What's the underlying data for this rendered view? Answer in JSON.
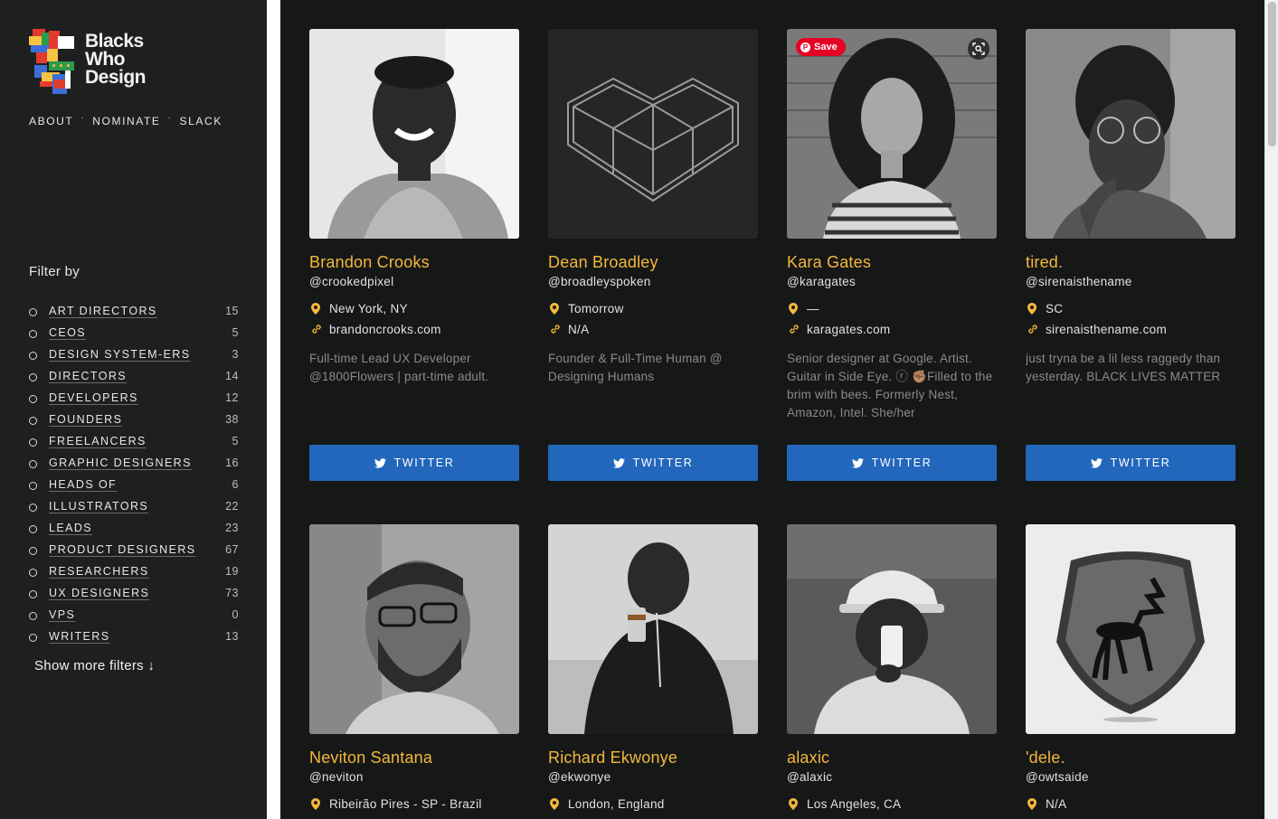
{
  "brand": {
    "line1": "Blacks",
    "line2": "Who",
    "line3": "Design"
  },
  "nav": {
    "about": "ABOUT",
    "sep": "·",
    "nominate": "NOMINATE",
    "slack": "SLACK"
  },
  "filters": {
    "title": "Filter by",
    "items": [
      {
        "label": "ART DIRECTORS",
        "count": "15"
      },
      {
        "label": "CEOS",
        "count": "5"
      },
      {
        "label": "DESIGN SYSTEM-ERS",
        "count": "3"
      },
      {
        "label": "DIRECTORS",
        "count": "14"
      },
      {
        "label": "DEVELOPERS",
        "count": "12"
      },
      {
        "label": "FOUNDERS",
        "count": "38"
      },
      {
        "label": "FREELANCERS",
        "count": "5"
      },
      {
        "label": "GRAPHIC DESIGNERS",
        "count": "16"
      },
      {
        "label": "HEADS OF",
        "count": "6"
      },
      {
        "label": "ILLUSTRATORS",
        "count": "22"
      },
      {
        "label": "LEADS",
        "count": "23"
      },
      {
        "label": "PRODUCT DESIGNERS",
        "count": "67"
      },
      {
        "label": "RESEARCHERS",
        "count": "19"
      },
      {
        "label": "UX DESIGNERS",
        "count": "73"
      },
      {
        "label": "VPS",
        "count": "0"
      },
      {
        "label": "WRITERS",
        "count": "13"
      }
    ],
    "show_more": "Show more filters ↓"
  },
  "cards": [
    {
      "name": "Brandon Crooks",
      "handle": "@crookedpixel",
      "location": "New York, NY",
      "website": "brandoncrooks.com",
      "bio": "Full-time Lead UX Developer @1800Flowers | part-time adult.",
      "button": "TWITTER"
    },
    {
      "name": "Dean Broadley",
      "handle": "@broadleyspoken",
      "location": "Tomorrow",
      "website": "N/A",
      "bio": "Founder & Full-Time Human @ Designing Humans",
      "button": "TWITTER"
    },
    {
      "name": "Kara Gates",
      "handle": "@karagates",
      "location": "—",
      "website": "karagates.com",
      "bio": "Senior designer at Google. Artist. Guitar in Side Eye. ⓡ ✊🏽Filled to the brim with bees. Formerly Nest, Amazon, Intel. She/her",
      "button": "TWITTER",
      "pin_label": "Save"
    },
    {
      "name": "tired.",
      "handle": "@sirenaisthename",
      "location": "SC",
      "website": "sirenaisthename.com",
      "bio": "just tryna be a lil less raggedy than yesterday. BLACK LIVES MATTER",
      "button": "TWITTER"
    },
    {
      "name": "Neviton Santana",
      "handle": "@neviton",
      "location": "Ribeirão Pires - SP - Brazil"
    },
    {
      "name": "Richard Ekwonye",
      "handle": "@ekwonye",
      "location": "London, England"
    },
    {
      "name": "alaxic",
      "handle": "@alaxic",
      "location": "Los Angeles, CA"
    },
    {
      "name": "'dele.",
      "handle": "@owtsaide",
      "location": "N/A"
    }
  ]
}
